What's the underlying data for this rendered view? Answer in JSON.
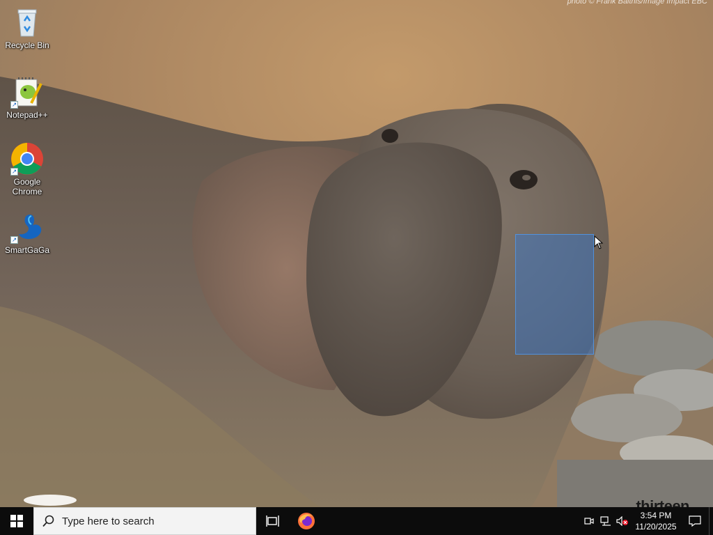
{
  "wallpaper": {
    "credit": "photo © Frank Balthis/Image Impact EBC",
    "watermark": "thirteen"
  },
  "desktop_icons": [
    {
      "label": "Recycle Bin",
      "icon": "recycle-bin-icon"
    },
    {
      "label": "Notepad++",
      "icon": "notepad-plus-plus-icon"
    },
    {
      "label": "Google Chrome",
      "icon": "chrome-icon"
    },
    {
      "label": "SmartGaGa",
      "icon": "smartgaga-icon"
    }
  ],
  "taskbar": {
    "search_placeholder": "Type here to search",
    "pinned": [
      "task-view-icon",
      "firefox-icon"
    ],
    "clock": {
      "time": "3:54 PM",
      "date": "11/20/2025"
    }
  },
  "colors": {
    "taskbar": "#0c0c0c",
    "selection": "#3378d2",
    "accent": "#0078d7"
  }
}
